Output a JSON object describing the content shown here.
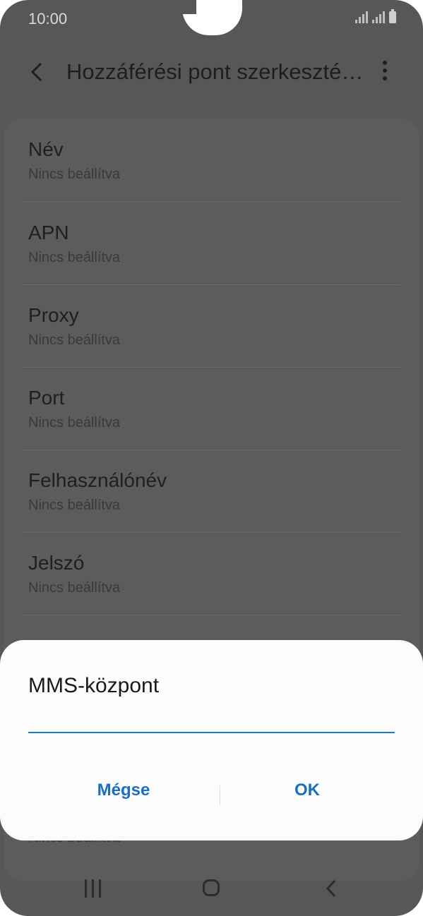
{
  "status_bar": {
    "time": "10:00"
  },
  "header": {
    "title": "Hozzáférési pont szerkeszté…"
  },
  "settings": [
    {
      "label": "Név",
      "value": "Nincs beállítva"
    },
    {
      "label": "APN",
      "value": "Nincs beállítva"
    },
    {
      "label": "Proxy",
      "value": "Nincs beállítva"
    },
    {
      "label": "Port",
      "value": "Nincs beállítva"
    },
    {
      "label": "Felhasználónév",
      "value": "Nincs beállítva"
    },
    {
      "label": "Jelszó",
      "value": "Nincs beállítva"
    }
  ],
  "partially_hidden_row": {
    "value": "Nincs beállítva"
  },
  "dialog": {
    "title": "MMS-központ",
    "input_value": "",
    "cancel_label": "Mégse",
    "ok_label": "OK"
  },
  "colors": {
    "accent": "#1b6fbf",
    "input_underline": "#1f7fc3",
    "dim_background": "#575757"
  }
}
